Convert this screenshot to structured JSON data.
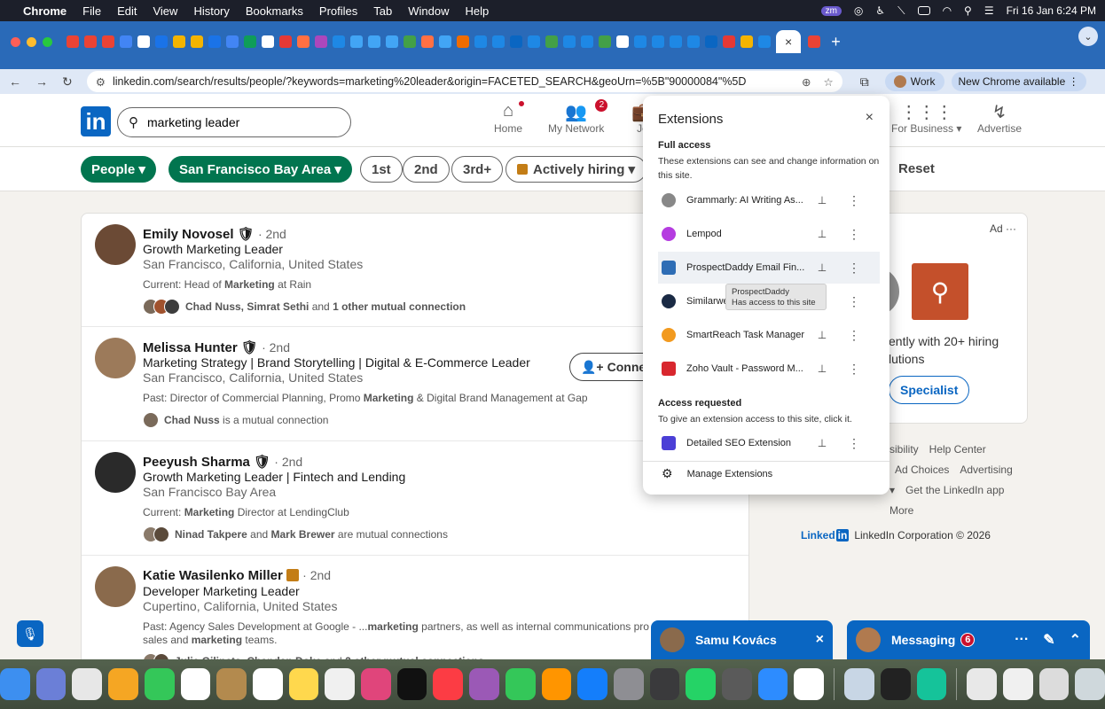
{
  "menubar": {
    "app": "Chrome",
    "items": [
      "File",
      "Edit",
      "View",
      "History",
      "Bookmarks",
      "Profiles",
      "Tab",
      "Window",
      "Help"
    ],
    "datetime": "Fri 16 Jan  6:24 PM",
    "zm": "zm"
  },
  "browser": {
    "url": "linkedin.com/search/results/people/?keywords=marketing%20leader&origin=FACETED_SEARCH&geoUrn=%5B\"90000084\"%5D",
    "profile_label": "Work",
    "update_label": "New Chrome available",
    "active_tab_close": "×",
    "new_tab": "+"
  },
  "linkedin": {
    "logo": "in",
    "search_value": "marketing leader",
    "nav": [
      {
        "label": "Home",
        "icon": "home-icon",
        "badge": ""
      },
      {
        "label": "My Network",
        "icon": "network-icon",
        "badge": "2"
      },
      {
        "label": "Jo",
        "icon": "jobs-icon",
        "badge": ""
      },
      {
        "label": "For Business ▾",
        "icon": "grid-icon",
        "badge": ""
      },
      {
        "label": "Advertise",
        "icon": "advertise-icon",
        "badge": ""
      }
    ],
    "filters": {
      "people": "People ▾",
      "location": "San Francisco Bay Area ▾",
      "first": "1st",
      "second": "2nd",
      "third": "3rd+",
      "hiring": "Actively hiring ▾",
      "reset": "Reset"
    },
    "results": [
      {
        "name": "Emily Novosel",
        "degree": "· 2nd",
        "headline": "Growth Marketing Leader",
        "location": "San Francisco, California, United States",
        "detail_prefix": "Current: Head of ",
        "detail_bold": "Marketing",
        "detail_suffix": " at Rain",
        "mutual_bold": "Chad Nuss, Simrat Sethi",
        "mutual_mid": " and ",
        "mutual_bold2": "1 other mutual connection",
        "mutual_tail": ""
      },
      {
        "name": "Melissa Hunter",
        "degree": "· 2nd",
        "headline": "Marketing Strategy | Brand Storytelling | Digital & E-Commerce Leader",
        "location": "San Francisco, California, United States",
        "detail_prefix": "Past: Director of Commercial Planning, Promo ",
        "detail_bold": "Marketing",
        "detail_suffix": " & Digital Brand Management at Gap",
        "mutual_bold": "Chad Nuss",
        "mutual_mid": " is a mutual connection",
        "mutual_bold2": "",
        "mutual_tail": ""
      },
      {
        "name": "Peeyush Sharma",
        "degree": "· 2nd",
        "headline": "Growth Marketing Leader | Fintech and Lending",
        "location": "San Francisco Bay Area",
        "detail_prefix": "Current: ",
        "detail_bold": "Marketing",
        "detail_suffix": " Director at LendingClub",
        "mutual_bold": "Ninad Takpere",
        "mutual_mid": " and ",
        "mutual_bold2": "Mark Brewer",
        "mutual_tail": " are mutual connections"
      },
      {
        "name": "Katie Wasilenko Miller",
        "degree": "· 2nd",
        "headline": "Developer Marketing Leader",
        "location": "Cupertino, California, United States",
        "detail_prefix": "Past: Agency Sales Development at Google - ...",
        "detail_bold": "marketing",
        "detail_suffix": " partners, as well as internal communications pro",
        "detail_line2_prefix": "sales and ",
        "detail_line2_bold": "marketing",
        "detail_line2_suffix": " teams.",
        "mutual_bold": "Julie Gilinets, Chandan Doke",
        "mutual_mid": " and ",
        "mutual_bold2": "2 other mutual connections",
        "mutual_tail": ""
      }
    ],
    "connect_label": "Connect",
    "ad": {
      "label": "Ad ···",
      "text": "ently with 20+ hiring lutions",
      "button": "Specialist"
    },
    "footer": {
      "row1": [
        "sibility",
        "Help Center"
      ],
      "row2": [
        "Ad Choices",
        "Advertising"
      ],
      "row3": [
        "▾",
        "Get the LinkedIn app"
      ],
      "row4": [
        "More"
      ],
      "logo": "Linked",
      "logo_in": "in",
      "copyright": "LinkedIn Corporation © 2026"
    },
    "messaging": {
      "chat_name": "Samu Kovács",
      "chat_close": "×",
      "title": "Messaging",
      "badge": "6",
      "more": "···",
      "compose": "✎",
      "collapse": "⌃"
    }
  },
  "extensions_popup": {
    "title": "Extensions",
    "close": "×",
    "full_access_heading": "Full access",
    "full_access_desc": "These extensions can see and change information on this site.",
    "items": [
      {
        "name": "Grammarly: AI Writing As...",
        "icon_color": "#888888"
      },
      {
        "name": "Lempod",
        "icon_color": "#b53ce0"
      },
      {
        "name": "ProspectDaddy Email Fin...",
        "icon_color": "#2e6db5"
      },
      {
        "name": "Similarweb",
        "icon_color": "#1a2a44"
      },
      {
        "name": "SmartReach Task Manager",
        "icon_color": "#f29a1f"
      },
      {
        "name": "Zoho Vault - Password M...",
        "icon_color": "#d8272e"
      }
    ],
    "tooltip_line1": "ProspectDaddy",
    "tooltip_line2": "Has access to this site",
    "requested_heading": "Access requested",
    "requested_desc": "To give an extension access to this site, click it.",
    "requested_items": [
      {
        "name": "Detailed SEO Extension",
        "icon_color": "#4b3fd6"
      }
    ],
    "manage_label": "Manage Extensions"
  },
  "colors": {
    "linkedin_blue": "#0a66c2",
    "filter_green": "#01754f",
    "tabbar": "#2a6ab8"
  }
}
